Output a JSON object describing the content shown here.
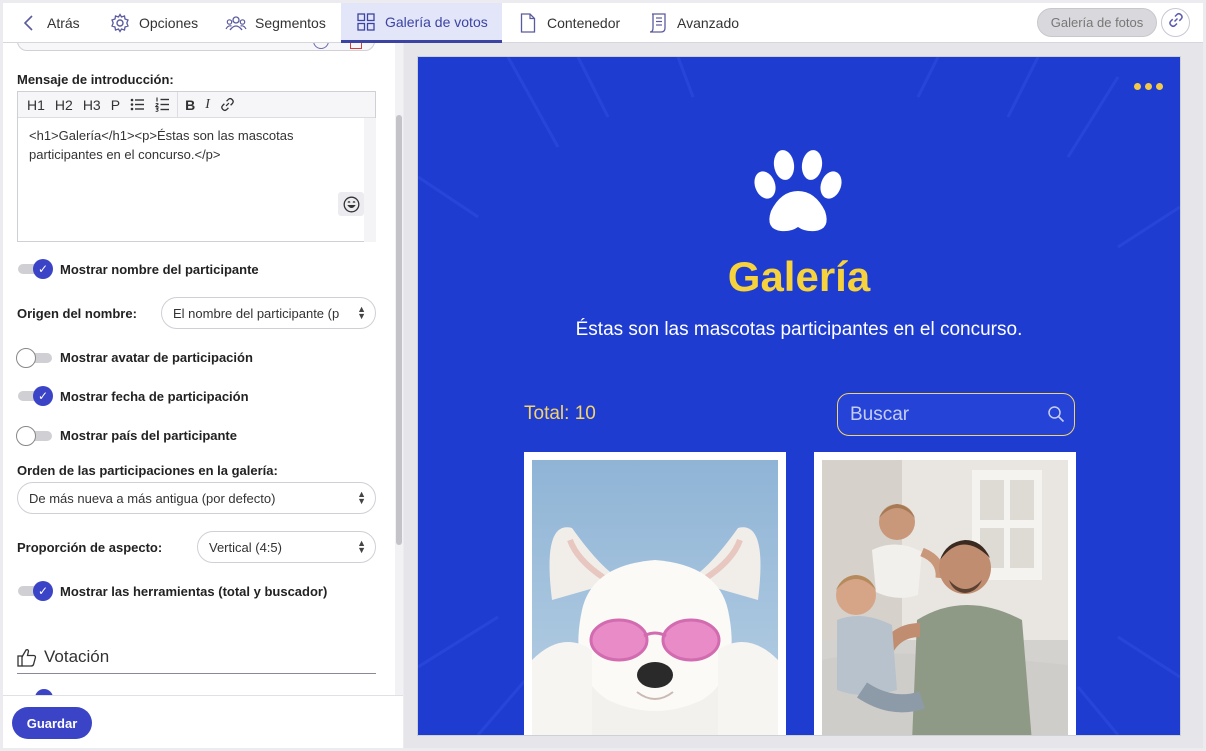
{
  "topbar": {
    "tabs": [
      {
        "label": "Atrás",
        "icon": "chevron-left-icon"
      },
      {
        "label": "Opciones",
        "icon": "gear-icon"
      },
      {
        "label": "Segmentos",
        "icon": "users-icon"
      },
      {
        "label": "Galería de votos",
        "icon": "grid-icon",
        "active": true
      },
      {
        "label": "Contenedor",
        "icon": "document-icon"
      },
      {
        "label": "Avanzado",
        "icon": "advanced-doc-icon"
      }
    ],
    "gallery_button": "Galería de fotos",
    "link_icon": "link-icon"
  },
  "left": {
    "intro_label": "Mensaje de introducción:",
    "editor_tools": [
      "H1",
      "H2",
      "H3",
      "P"
    ],
    "editor_content": "<h1>Galería</h1><p>Éstas son las mascotas participantes en el concurso.</p>",
    "toggles": [
      {
        "label": "Mostrar nombre del participante",
        "on": true
      },
      {
        "label": "Mostrar avatar de participación",
        "on": false
      },
      {
        "label": "Mostrar fecha de participación",
        "on": true
      },
      {
        "label": "Mostrar país del participante",
        "on": false
      },
      {
        "label": "Mostrar las herramientas (total y buscador)",
        "on": true
      }
    ],
    "name_origin_label": "Origen del nombre:",
    "name_origin_value": "El nombre del participante (p",
    "order_label": "Orden de las participaciones en la galería:",
    "order_value": "De más nueva a más antigua (por defecto)",
    "aspect_label": "Proporción de aspecto:",
    "aspect_value": "Vertical (4:5)",
    "voting_section": "Votación",
    "save_button": "Guardar"
  },
  "preview": {
    "title": "Galería",
    "subtitle": "Éstas son las mascotas participantes en el concurso.",
    "total": "Total: 10",
    "search_placeholder": "Buscar",
    "colors": {
      "background": "#1f3cd1",
      "accent": "#f6d23c"
    }
  }
}
